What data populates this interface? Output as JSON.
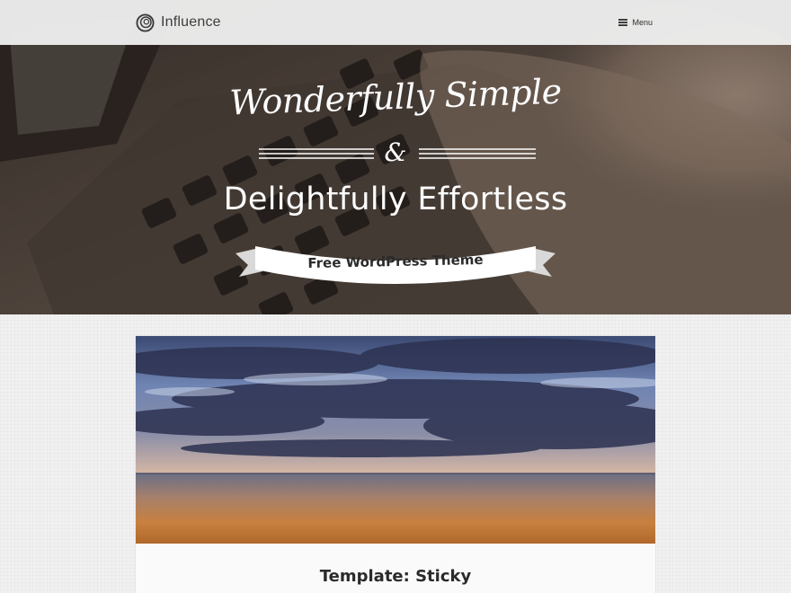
{
  "header": {
    "site_title": "Influence",
    "logo_icon": "circle-swirl-logo-icon",
    "menu_label": "Menu",
    "menu_icon": "hamburger-icon"
  },
  "hero": {
    "script_line": "Wonderfully Simple",
    "ampersand": "&",
    "heading": "Delightfully Effortless",
    "ribbon_text": "Free WordPress Theme"
  },
  "post": {
    "title": "Template: Sticky"
  },
  "colors": {
    "page_background": "#f1f1f1",
    "header_background": "#eeeeee",
    "text_dark": "#2a2a2a",
    "hero_text": "#ffffff"
  }
}
